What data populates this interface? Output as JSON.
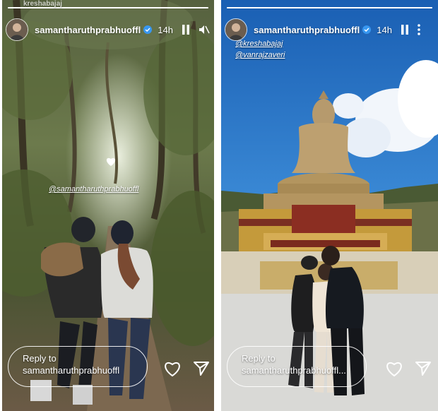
{
  "stories": [
    {
      "username": "samantharuthprabhuoffl",
      "time": "14h",
      "overlay_watermark": "kreshabajaj",
      "mentions": [
        "@samantharuthprabhuoffl"
      ],
      "reply_label": "Reply to",
      "reply_name": "samantharuthprabhuoffl",
      "progress": 1.0
    },
    {
      "username": "samantharuthprabhuoffl",
      "time": "14h",
      "mentions": [
        "@kreshabajaj",
        "@vanrajzaveri"
      ],
      "reply_label": "Reply to",
      "reply_name": "samantharuthprabhuoffl...",
      "progress": 1.0
    }
  ],
  "icons": {
    "verified": "verified-badge-icon",
    "pause": "pause-icon",
    "mute": "mute-icon",
    "more": "more-icon",
    "like": "heart-icon",
    "share": "send-icon"
  },
  "colors": {
    "verified_blue": "#3897f0",
    "forest_dark": "#2f3a22",
    "sky_blue": "#2f7fd0"
  }
}
